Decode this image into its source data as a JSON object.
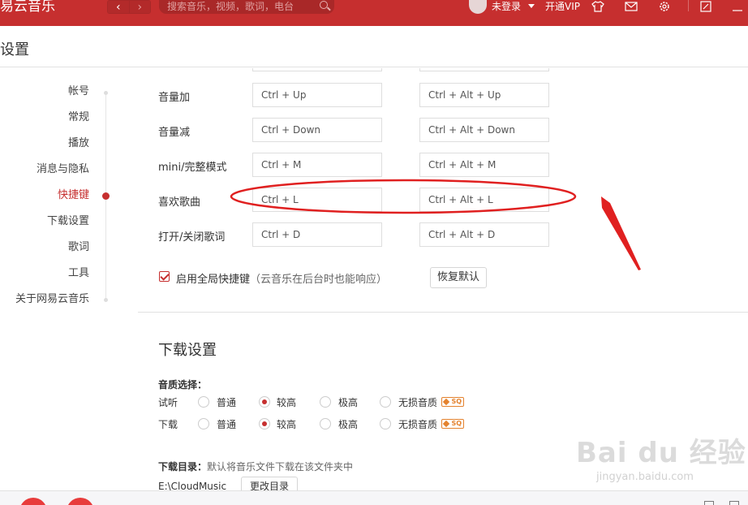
{
  "window": {
    "brand": "易云音乐",
    "search_placeholder": "搜索音乐，视频，歌词，电台",
    "login_label": "未登录",
    "vip_label": "开通VIP",
    "icons": [
      "tshirt-icon",
      "mail-icon",
      "gear-icon",
      "mini-mode-icon"
    ]
  },
  "page": {
    "title": "设置"
  },
  "sidebar": {
    "items": [
      {
        "label": "帐号",
        "active": false
      },
      {
        "label": "常规",
        "active": false
      },
      {
        "label": "播放",
        "active": false
      },
      {
        "label": "消息与隐私",
        "active": false
      },
      {
        "label": "快捷键",
        "active": true
      },
      {
        "label": "下载设置",
        "active": false
      },
      {
        "label": "歌词",
        "active": false
      },
      {
        "label": "工具",
        "active": false
      },
      {
        "label": "关于网易云音乐",
        "active": false
      }
    ]
  },
  "shortcuts": {
    "rows": [
      {
        "action": "音量加",
        "local": "Ctrl + Up",
        "global": "Ctrl + Alt + Up"
      },
      {
        "action": "音量减",
        "local": "Ctrl + Down",
        "global": "Ctrl + Alt + Down"
      },
      {
        "action": "mini/完整模式",
        "local": "Ctrl + M",
        "global": "Ctrl + Alt + M"
      },
      {
        "action": "喜欢歌曲",
        "local": "Ctrl + L",
        "global": "Ctrl + Alt + L"
      },
      {
        "action": "打开/关闭歌词",
        "local": "Ctrl + D",
        "global": "Ctrl + Alt + D"
      }
    ],
    "global_enable_label": "启用全局快捷键",
    "global_enable_note": "（云音乐在后台时也能响应）",
    "global_enable_checked": true,
    "reset_label": "恢复默认"
  },
  "download": {
    "section_title": "下载设置",
    "quality_title": "音质选择：",
    "rows": [
      {
        "label": "试听",
        "selected": "较高"
      },
      {
        "label": "下载",
        "selected": "较高"
      }
    ],
    "options": [
      "普通",
      "较高",
      "极高",
      "无损音质"
    ],
    "sq_badge": "SQ",
    "dir_title": "下载目录：",
    "dir_note": "默认将音乐文件下载在该文件夹中",
    "dir_path": "E:\\CloudMusic",
    "change_dir_label": "更改目录"
  },
  "annotation": {
    "highlight_color": "#e02020"
  },
  "watermark": {
    "line1": "Bai du 经验",
    "line2": "jingyan.baidu.com"
  }
}
